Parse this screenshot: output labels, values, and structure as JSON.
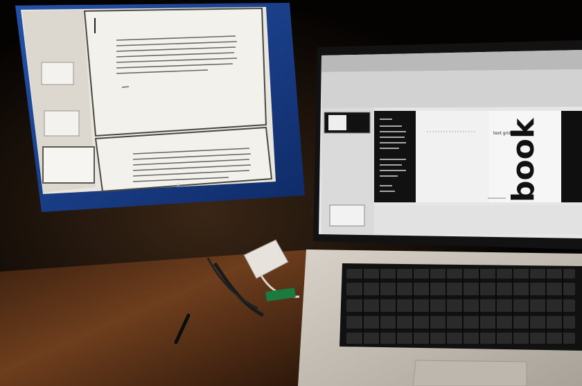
{
  "photo": {
    "description_visible": false
  },
  "laptop_screen": {
    "cover_title": "book",
    "inner_heading": "text grid"
  },
  "colors": {
    "desk_wood": "#5a3218",
    "desk_dark": "#1a0e08",
    "monitor_bezel": "#1b3f8a",
    "screen_paper": "#eeeae4",
    "laptop_body": "#c9c3b9",
    "keyboard": "#121212",
    "cover_black": "#111111"
  }
}
